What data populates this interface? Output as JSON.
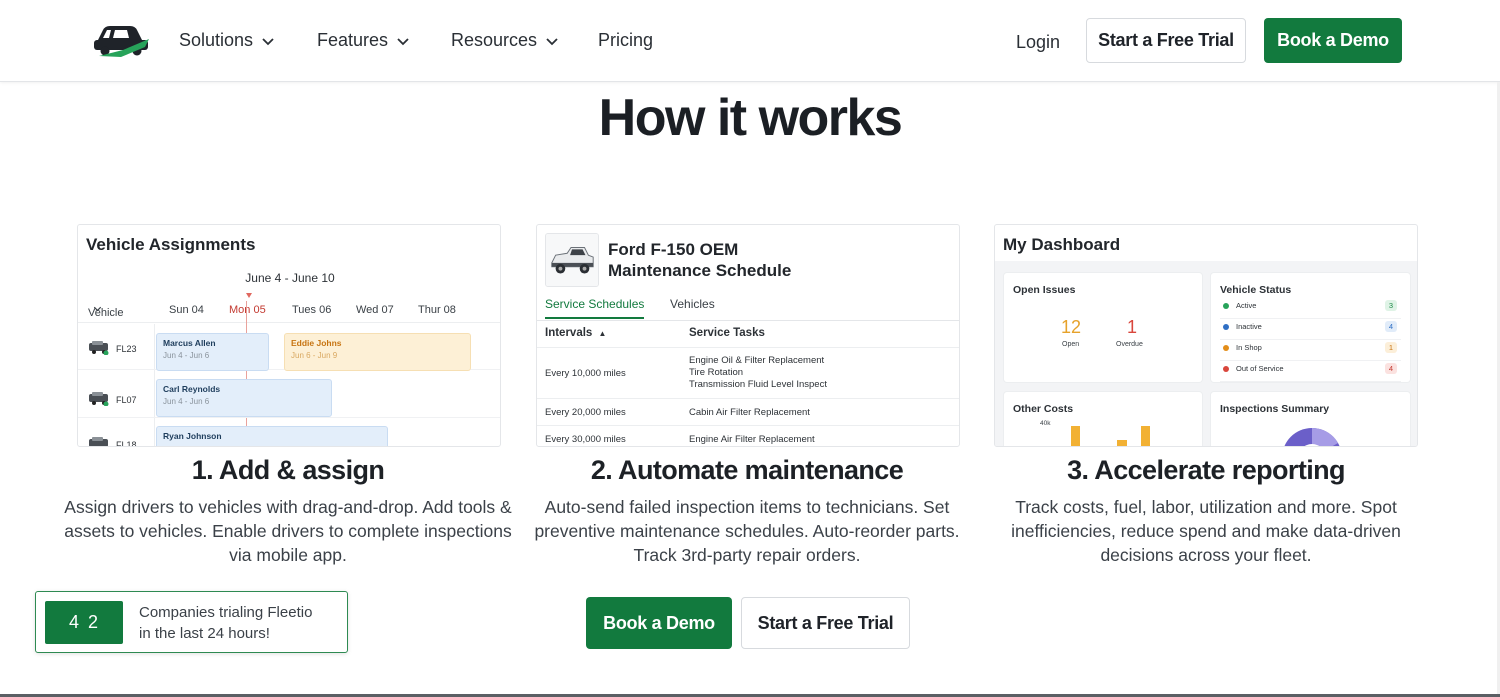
{
  "nav": {
    "items": [
      {
        "label": "Solutions",
        "has_dropdown": true
      },
      {
        "label": "Features",
        "has_dropdown": true
      },
      {
        "label": "Resources",
        "has_dropdown": true
      },
      {
        "label": "Pricing",
        "has_dropdown": false
      }
    ],
    "login": "Login",
    "trial": "Start a Free Trial",
    "demo": "Book a Demo",
    "logo_icon": "fleetio-car-logo-icon"
  },
  "headline": "How it works",
  "card1": {
    "title": "Vehicle Assignments",
    "dates": "June 4 - June 10",
    "col_vehicle": "Vehicle",
    "days": [
      "Sun 04",
      "Mon 05",
      "Tues 06",
      "Wed 07",
      "Thur 08"
    ],
    "rows": [
      {
        "id": "FL23",
        "assignments": [
          {
            "name": "Marcus Allen",
            "dates": "Jun 4 - Jun 6"
          },
          {
            "name": "Eddie Johns",
            "dates": "Jun 6 - Jun 9"
          }
        ]
      },
      {
        "id": "FL07",
        "assignments": [
          {
            "name": "Carl Reynolds",
            "dates": "Jun 4 - Jun 6"
          }
        ]
      },
      {
        "id": "FL18",
        "assignments": [
          {
            "name": "Ryan Johnson",
            "dates": ""
          }
        ]
      }
    ]
  },
  "card2": {
    "title_line1": "Ford F-150 OEM",
    "title_line2": "Maintenance Schedule",
    "tabs": [
      "Service Schedules",
      "Vehicles"
    ],
    "col_intervals": "Intervals",
    "col_tasks": "Service Tasks",
    "rows": [
      {
        "interval": "Every 10,000 miles",
        "tasks": [
          "Engine Oil & Filter Replacement",
          "Tire Rotation",
          "Transmission Fluid Level Inspect"
        ]
      },
      {
        "interval": "Every 20,000 miles",
        "tasks": [
          "Cabin Air Filter Replacement"
        ]
      },
      {
        "interval": "Every 30,000 miles",
        "tasks": [
          "Engine Air Filter Replacement"
        ]
      }
    ]
  },
  "card3": {
    "title": "My Dashboard",
    "open_issues": {
      "title": "Open Issues",
      "open_value": "12",
      "open_label": "Open",
      "overdue_value": "1",
      "overdue_label": "Overdue"
    },
    "vehicle_status": {
      "title": "Vehicle Status",
      "rows": [
        {
          "label": "Active",
          "count": "3",
          "color": "#27a35a",
          "badge_bg": "#dff3e6",
          "badge_fg": "#1e8a48"
        },
        {
          "label": "Inactive",
          "count": "4",
          "color": "#2f6fc4",
          "badge_bg": "#e1ecf9",
          "badge_fg": "#2f6fc4"
        },
        {
          "label": "In Shop",
          "count": "1",
          "color": "#e38d19",
          "badge_bg": "#fcefd9",
          "badge_fg": "#c77412"
        },
        {
          "label": "Out of Service",
          "count": "4",
          "color": "#d9463c",
          "badge_bg": "#fbe2e0",
          "badge_fg": "#c33a31"
        }
      ]
    },
    "other_costs": {
      "title": "Other Costs",
      "axis": "40k"
    },
    "inspections": {
      "title": "Inspections Summary"
    }
  },
  "steps": [
    {
      "title": "1. Add & assign",
      "desc": "Assign drivers to vehicles with drag-and-drop. Add tools & assets to vehicles. Enable drivers to complete inspections via mobile app."
    },
    {
      "title": "2. Automate maintenance",
      "desc": "Auto-send failed inspection items to technicians. Set preventive maintenance schedules. Auto-reorder parts. Track 3rd-party repair orders."
    },
    {
      "title": "3. Accelerate reporting",
      "desc": "Track costs, fuel, labor, utilization and more. Spot inefficiencies, reduce spend and make data-driven decisions across your fleet."
    }
  ],
  "cta": {
    "demo": "Book a Demo",
    "trial": "Start a Free Trial"
  },
  "trial_box": {
    "count": "42",
    "text_line1": "Companies trialing Fleetio",
    "text_line2": "in the last 24 hours!"
  },
  "colors": {
    "brand_green": "#127a3e",
    "accent_orange": "#e6a22b",
    "accent_red": "#d9463c"
  }
}
